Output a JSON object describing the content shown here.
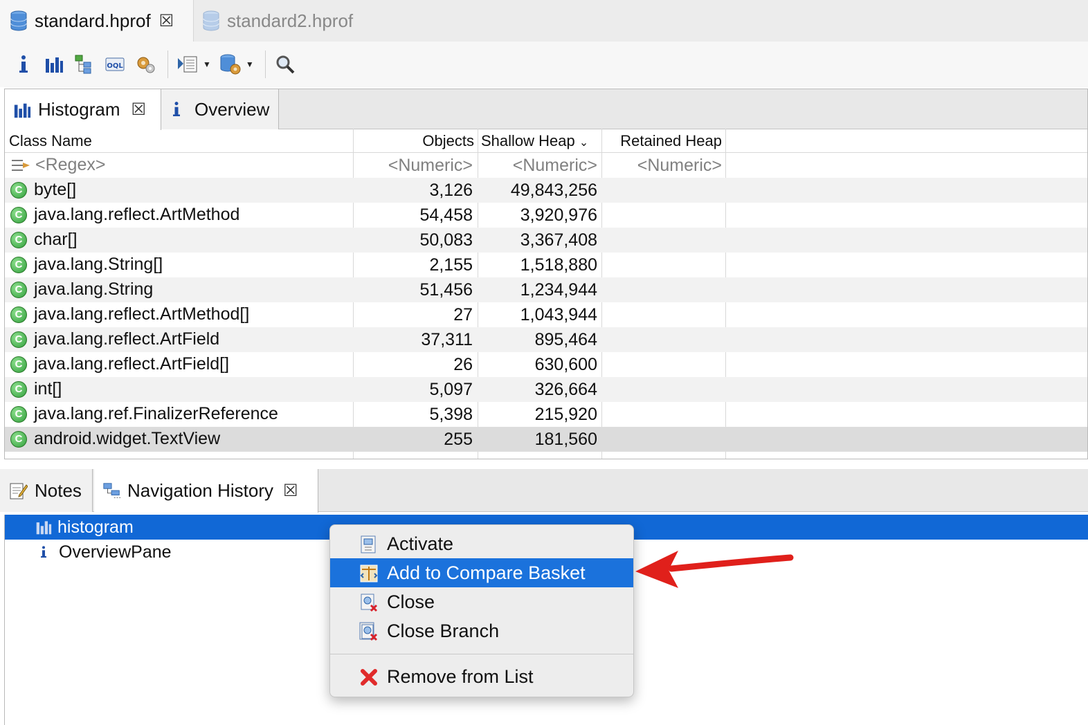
{
  "file_tabs": [
    {
      "label": "standard.hprof",
      "active": true
    },
    {
      "label": "standard2.hprof",
      "active": false
    }
  ],
  "toolbar": {
    "buttons": [
      "info-icon",
      "histogram-icon",
      "dominator-tree-icon",
      "oql-icon",
      "thread-overview-icon",
      "run-report-icon",
      "heap-dump-icon",
      "search-icon"
    ]
  },
  "editor": {
    "tabs": [
      {
        "label": "Histogram",
        "active": true
      },
      {
        "label": "Overview",
        "active": false
      }
    ],
    "columns": {
      "class_name": "Class Name",
      "objects": "Objects",
      "shallow_heap": "Shallow Heap",
      "retained_heap": "Retained Heap"
    },
    "filter": {
      "name": "<Regex>",
      "objects": "<Numeric>",
      "shallow": "<Numeric>",
      "retained": "<Numeric>"
    },
    "rows": [
      {
        "name": "byte[]",
        "objects": "3,126",
        "shallow": "49,843,256"
      },
      {
        "name": "java.lang.reflect.ArtMethod",
        "objects": "54,458",
        "shallow": "3,920,976"
      },
      {
        "name": "char[]",
        "objects": "50,083",
        "shallow": "3,367,408"
      },
      {
        "name": "java.lang.String[]",
        "objects": "2,155",
        "shallow": "1,518,880"
      },
      {
        "name": "java.lang.String",
        "objects": "51,456",
        "shallow": "1,234,944"
      },
      {
        "name": "java.lang.reflect.ArtMethod[]",
        "objects": "27",
        "shallow": "1,043,944"
      },
      {
        "name": "java.lang.reflect.ArtField",
        "objects": "37,311",
        "shallow": "895,464"
      },
      {
        "name": "java.lang.reflect.ArtField[]",
        "objects": "26",
        "shallow": "630,600"
      },
      {
        "name": "int[]",
        "objects": "5,097",
        "shallow": "326,664"
      },
      {
        "name": "java.lang.ref.FinalizerReference",
        "objects": "5,398",
        "shallow": "215,920"
      },
      {
        "name": "android.widget.TextView",
        "objects": "255",
        "shallow": "181,560"
      }
    ],
    "class_icon_letter": "C"
  },
  "bottom": {
    "tabs": [
      {
        "label": "Notes"
      },
      {
        "label": "Navigation History"
      }
    ],
    "tree": [
      {
        "label": "histogram",
        "selected": true
      },
      {
        "label": "OverviewPane",
        "selected": false
      }
    ]
  },
  "context_menu": {
    "items": [
      {
        "label": "Activate",
        "icon": "activate-icon"
      },
      {
        "label": "Add to Compare Basket",
        "icon": "compare-basket-icon",
        "highlighted": true
      },
      {
        "label": "Close",
        "icon": "close-query-icon"
      },
      {
        "label": "Close Branch",
        "icon": "close-branch-icon"
      },
      {
        "label": "Remove from List",
        "icon": "remove-icon"
      }
    ]
  },
  "colors": {
    "selection": "#1168d6",
    "menu_highlight": "#1b72dc",
    "annotation_arrow": "#e0201b",
    "class_icon": "#2f9e3a"
  }
}
